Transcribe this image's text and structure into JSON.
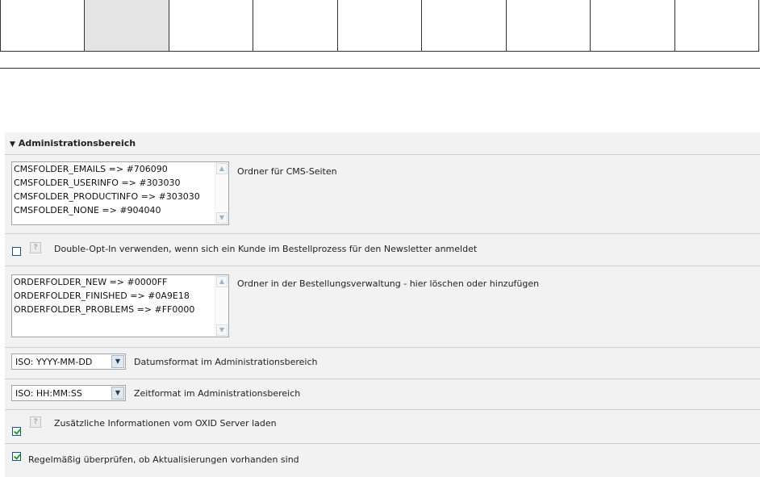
{
  "tabs": [
    "",
    "",
    "",
    "",
    "",
    "",
    "",
    "",
    ""
  ],
  "active_tab_index": 1,
  "section": {
    "title": "Administrationsbereich",
    "toggle_icon": "triangle-down-icon"
  },
  "cms_folders": {
    "options": [
      "CMSFOLDER_EMAILS => #706090",
      "CMSFOLDER_USERINFO => #303030",
      "CMSFOLDER_PRODUCTINFO => #303030",
      "CMSFOLDER_NONE => #904040"
    ],
    "label": "Ordner für CMS-Seiten"
  },
  "double_opt_in": {
    "checked": false,
    "help_icon": "?",
    "label": "Double-Opt-In verwenden, wenn sich ein Kunde im Bestellprozess für den Newsletter anmeldet"
  },
  "order_folders": {
    "options": [
      "ORDERFOLDER_NEW => #0000FF",
      "ORDERFOLDER_FINISHED => #0A9E18",
      "ORDERFOLDER_PROBLEMS => #FF0000"
    ],
    "label": "Ordner in der Bestellungsverwaltung - hier löschen oder hinzufügen"
  },
  "date_format": {
    "value": "ISO: YYYY-MM-DD",
    "label": "Datumsformat im Administrationsbereich"
  },
  "time_format": {
    "value": "ISO: HH:MM:SS",
    "label": "Zeitformat im Administrationsbereich"
  },
  "oxid_info": {
    "checked": true,
    "help_icon": "?",
    "label": "Zusätzliche Informationen vom OXID Server laden"
  },
  "check_updates": {
    "checked": true,
    "label": "Regelmäßig überprüfen, ob Aktualisierungen vorhanden sind"
  },
  "icons": {
    "scroll_up": "▲",
    "scroll_down": "▼",
    "dropdown": "▼",
    "triangle": "▼"
  }
}
